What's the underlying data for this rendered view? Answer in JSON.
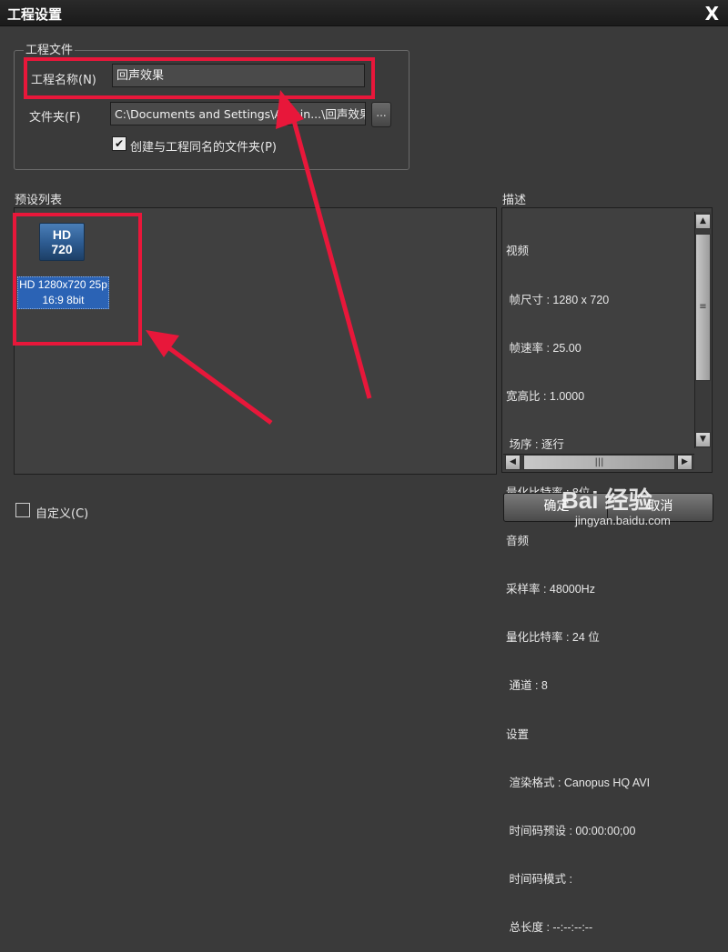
{
  "window": {
    "title": "工程设置",
    "close_glyph": "X"
  },
  "project_file": {
    "legend": "工程文件",
    "name_label": "工程名称(N)",
    "name_value": "回声效果",
    "folder_label": "文件夹(F)",
    "folder_value": "C:\\Documents and Settings\\Admin...\\回声效果",
    "browse_label": "...",
    "create_folder_label": "创建与工程同名的文件夹(P)",
    "create_folder_checked": true
  },
  "presets": {
    "label": "预设列表",
    "items": [
      {
        "icon_line1": "HD",
        "icon_line2": "720",
        "line1": "HD 1280x720 25p",
        "line2": "16:9 8bit"
      }
    ]
  },
  "description": {
    "label": "描述",
    "lines": [
      "视频",
      " 帧尺寸 : 1280 x 720",
      " 帧速率 : 25.00",
      "宽高比 : 1.0000",
      " 场序 : 逐行",
      "量化比特率 : 8位",
      "音频",
      "采样率 : 48000Hz",
      "量化比特率 : 24 位",
      " 通道 : 8",
      "设置",
      " 渲染格式 : Canopus HQ AVI",
      " 时间码预设 : 00:00:00;00",
      " 时间码模式 :",
      " 总长度 : --:--:--:--"
    ]
  },
  "custom_label": "自定义(C)",
  "buttons": {
    "ok": "确定",
    "cancel": "取消"
  },
  "watermark": {
    "brand": "Bai 经验",
    "url": "jingyan.baidu.com"
  },
  "colors": {
    "annotation_red": "#e8173a",
    "selection_blue": "#2b63b5"
  }
}
